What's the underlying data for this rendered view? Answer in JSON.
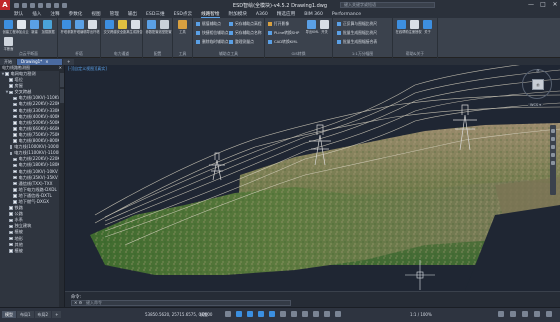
{
  "titlebar": {
    "title": "ESD智绘(全模块)-v4.5.2    Drawing1.dwg",
    "search_placeholder": "键入关键字或短语",
    "controls": [
      "—",
      "□",
      "✕"
    ]
  },
  "menu": {
    "tabs": [
      {
        "label": "默认"
      },
      {
        "label": "插入"
      },
      {
        "label": "注释"
      },
      {
        "label": "参数化"
      },
      {
        "label": "视图"
      },
      {
        "label": "管理"
      },
      {
        "label": "输出"
      },
      {
        "label": "ESD三维"
      },
      {
        "label": "ESD点云"
      },
      {
        "label": "线路智绘",
        "active": true
      },
      {
        "label": "附加模块"
      },
      {
        "label": "A360"
      },
      {
        "label": "精选应用"
      },
      {
        "label": "BIM 360"
      },
      {
        "label": "Performance"
      }
    ]
  },
  "ribbon": {
    "groups": [
      {
        "label": "点云平断面",
        "buttons": [
          "创建工程",
          "添加点云",
          "新建",
          "加载数据",
          "平断面"
        ]
      },
      {
        "label": "杆塔",
        "buttons": [
          "杆塔参数",
          "杆塔编辑",
          "导出杆塔"
        ]
      },
      {
        "label": "电力通道",
        "buttons": [
          "交叉跨越",
          "安全距离",
          "生成报告"
        ]
      },
      {
        "label": "配置",
        "buttons": [
          "参数配置",
          "线型配置"
        ]
      },
      {
        "label": "工具",
        "buttons": [
          "工具",
          "工具"
        ]
      }
    ],
    "small_rows": [
      "赋值辅助点",
      "另存辅助点高程",
      "快捷相位辅助点",
      "另存辅助点名称",
      "删除临时辅助点",
      "整理测量点"
    ],
    "small_group_label": "辅助点工具",
    "gis_buttons": [
      "打开影像",
      "PLine转换SHP",
      "CAD转换KML",
      "导出KML",
      "导入KML",
      "开关",
      "开关"
    ],
    "gis_label": "GIS转换",
    "map_rows": [
      "正反算与图幅比例尺",
      "批量生成图幅比例尺",
      "批量生成图幅接合表"
    ],
    "map_label": "1:1万分幅图",
    "help_buttons": [
      "在线帮助",
      "注册授权",
      "关于"
    ],
    "help_label": "帮助&关于"
  },
  "doctabs": [
    {
      "label": "开始"
    },
    {
      "label": "Drawing1*",
      "active": true
    }
  ],
  "tree": {
    "header": "电力线路勘测图",
    "items": [
      {
        "label": "电网电力勘测",
        "level": 0,
        "expander": "▼"
      },
      {
        "label": "塔位",
        "level": 1,
        "expander": ""
      },
      {
        "label": "房屋",
        "level": 1,
        "expander": ""
      },
      {
        "label": "交叉跨越",
        "level": 1,
        "expander": "▼"
      },
      {
        "label": "电力线(10KV)-110KV",
        "level": 2
      },
      {
        "label": "电力线(220KV)-220KV",
        "level": 2
      },
      {
        "label": "电力线(330KV)-330KV",
        "level": 2
      },
      {
        "label": "电力线(400KV)-400KV",
        "level": 2
      },
      {
        "label": "电力线(500KV)-500KV",
        "level": 2
      },
      {
        "label": "电力线(660KV)-660KV",
        "level": 2
      },
      {
        "label": "电力线(750KV)-750KV",
        "level": 2
      },
      {
        "label": "电力线(800KV)-800KV",
        "level": 2
      },
      {
        "label": "电力线(1000KV)-1000KV",
        "level": 2
      },
      {
        "label": "电力线(1100KV)-1100KV",
        "level": 2
      },
      {
        "label": "电力线(220KV)-220KV",
        "level": 2
      },
      {
        "label": "电力线(180KV)-180KV",
        "level": 2
      },
      {
        "label": "电力线(10KV)-10KV",
        "level": 2
      },
      {
        "label": "电力线(35KV)-35KV",
        "level": 2
      },
      {
        "label": "通信线(TXX)-TXX",
        "level": 2
      },
      {
        "label": "地下电力线路-DXDL",
        "level": 2
      },
      {
        "label": "地下通信线-DXTL",
        "level": 2
      },
      {
        "label": "地下燃气-DXGX",
        "level": 2
      },
      {
        "label": "铁路",
        "level": 1
      },
      {
        "label": "公路",
        "level": 1
      },
      {
        "label": "水系",
        "level": 1
      },
      {
        "label": "独立建筑",
        "level": 1
      },
      {
        "label": "植被",
        "level": 1
      },
      {
        "label": "地形",
        "level": 1
      },
      {
        "label": "其他",
        "level": 1
      },
      {
        "label": "植被",
        "level": 1
      }
    ]
  },
  "viewport": {
    "label_prefix": "[-]",
    "label_view": "[自定义视图]",
    "label_style": "[真实]",
    "viewcube_face": "前",
    "viewcube_north": "北",
    "wcs": "WCS ▾"
  },
  "command": {
    "prev": "命令:",
    "placeholder": "键入命令",
    "close": "✕ ⚙"
  },
  "status": {
    "layout_tabs": [
      {
        "label": "模型",
        "active": true
      },
      {
        "label": "布局1"
      },
      {
        "label": "布局2"
      },
      {
        "label": "+"
      }
    ],
    "coords": "53850.5620, 25715.6575, 0.0000",
    "model": "模型",
    "scale": "1:1 / 100%"
  },
  "colors": {
    "accent": "#3b8fe0",
    "sky_top": "#1f2633",
    "terrain_green": "#4e7a3a",
    "terrain_brown": "#8a7a62"
  }
}
